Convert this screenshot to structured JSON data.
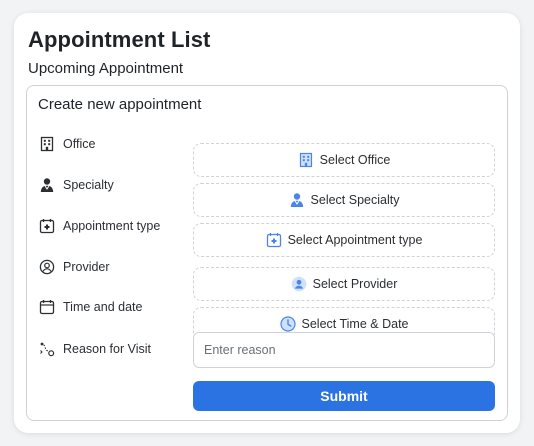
{
  "header": {
    "title": "Appointment List",
    "section_title": "Upcoming Appointment"
  },
  "form": {
    "title": "Create new appointment",
    "rows": [
      {
        "label": "Office",
        "icon": "office-building-icon",
        "picker_label": "Select Office",
        "picker_icon": "office-building-icon"
      },
      {
        "label": "Specialty",
        "icon": "doctor-icon",
        "picker_label": "Select Specialty",
        "picker_icon": "doctor-icon"
      },
      {
        "label": "Appointment type",
        "icon": "medical-calendar-icon",
        "picker_label": "Select Appointment type",
        "picker_icon": "medical-calendar-icon"
      },
      {
        "label": "Provider",
        "icon": "user-circle-icon",
        "picker_label": "Select Provider",
        "picker_icon": "provider-avatar-icon"
      },
      {
        "label": "Time and date",
        "icon": "calendar-icon",
        "picker_label": "Select Time & Date",
        "picker_icon": "clock-icon"
      }
    ],
    "reason": {
      "label": "Reason for Visit",
      "icon": "route-icon",
      "placeholder": "Enter reason",
      "value": ""
    },
    "submit_label": "Submit"
  },
  "colors": {
    "accent": "#2b73e3",
    "icon_blue": "#4a86e8",
    "icon_light": "#cfe0fb",
    "border": "#cfd3d8",
    "background": "#f2f3f5"
  }
}
